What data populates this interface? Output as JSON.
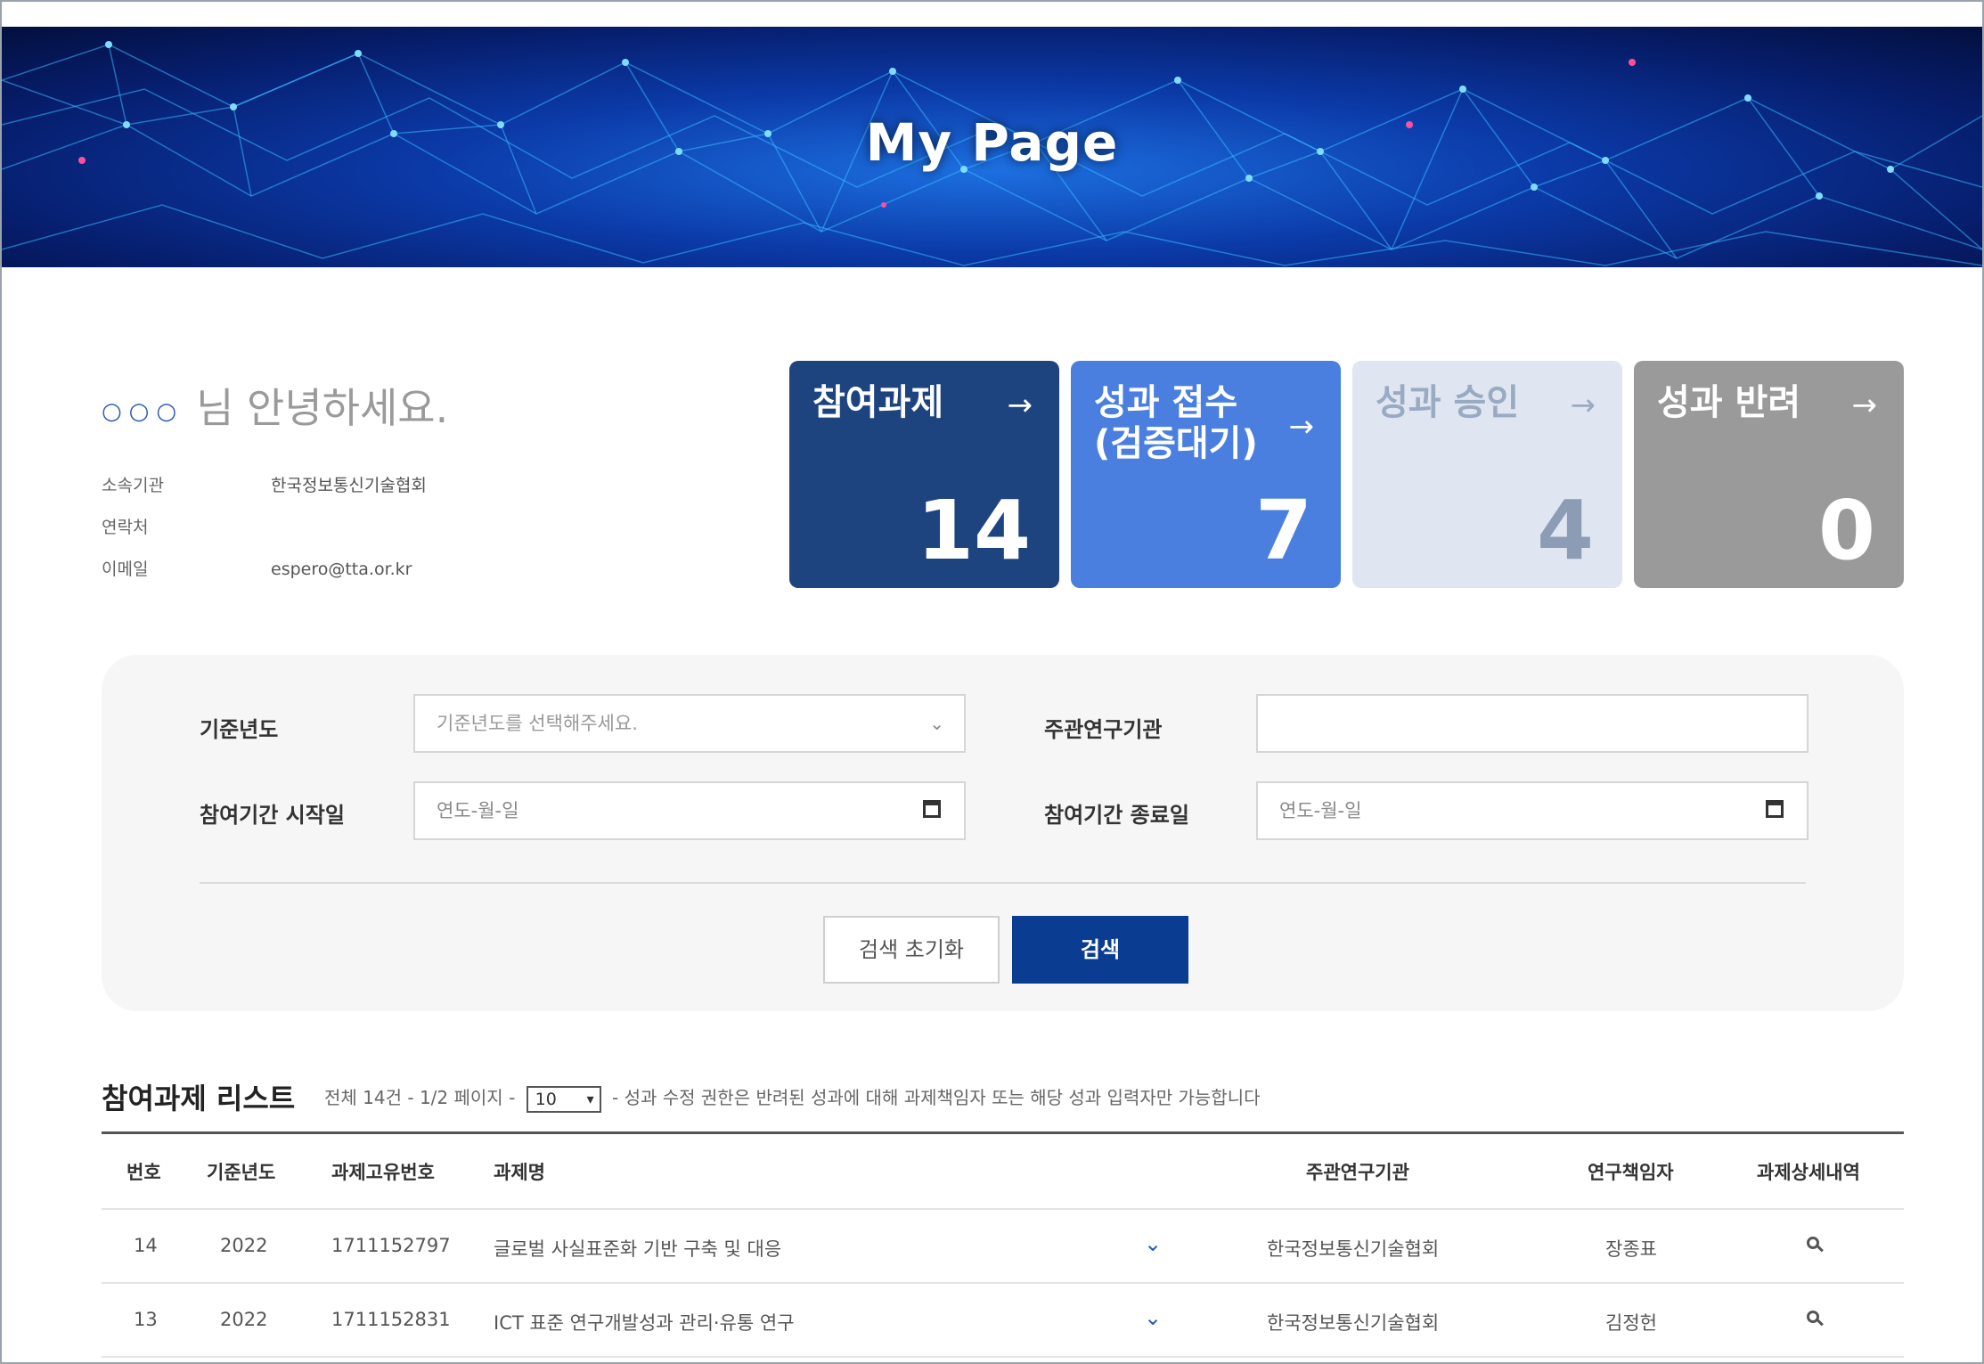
{
  "banner": {
    "title": "My Page"
  },
  "user": {
    "greeting_dots": "○○○",
    "greeting": "님 안녕하세요.",
    "affiliation_label": "소속기관",
    "affiliation": "한국정보통신기술협회",
    "contact_label": "연락처",
    "contact": "",
    "email_label": "이메일",
    "email": "espero@tta.or.kr"
  },
  "cards": [
    {
      "title": "참여과제",
      "count": "14",
      "arrow": "→"
    },
    {
      "title": "성과 접수\n(검증대기)",
      "count": "7",
      "arrow": "→"
    },
    {
      "title": "성과 승인",
      "count": "4",
      "arrow": "→"
    },
    {
      "title": "성과 반려",
      "count": "0",
      "arrow": "→"
    }
  ],
  "search": {
    "year_label": "기준년도",
    "year_placeholder": "기준년도를 선택해주세요.",
    "org_label": "주관연구기관",
    "org_value": "",
    "start_label": "참여기간 시작일",
    "start_placeholder": "연도-월-일",
    "end_label": "참여기간 종료일",
    "end_placeholder": "연도-월-일",
    "reset_button": "검색 초기화",
    "search_button": "검색"
  },
  "list": {
    "title": "참여과제 리스트",
    "total": "전체 14건",
    "page": "1/2 페이지",
    "page_size": "10",
    "notice": "- 성과 수정 권한은 반려된 성과에 대해 과제책임자 또는 해당 성과 입력자만 가능합니다",
    "headers": [
      "번호",
      "기준년도",
      "과제고유번호",
      "과제명",
      "주관연구기관",
      "연구책임자",
      "과제상세내역"
    ],
    "rows": [
      {
        "no": "14",
        "year": "2022",
        "id": "1711152797",
        "name": "글로벌 사실표준화 기반 구축 및 대응",
        "org": "한국정보통신기술협회",
        "pi": "장종표"
      },
      {
        "no": "13",
        "year": "2022",
        "id": "1711152831",
        "name": "ICT 표준 연구개발성과 관리·유통 연구",
        "org": "한국정보통신기술협회",
        "pi": "김정헌"
      }
    ]
  }
}
